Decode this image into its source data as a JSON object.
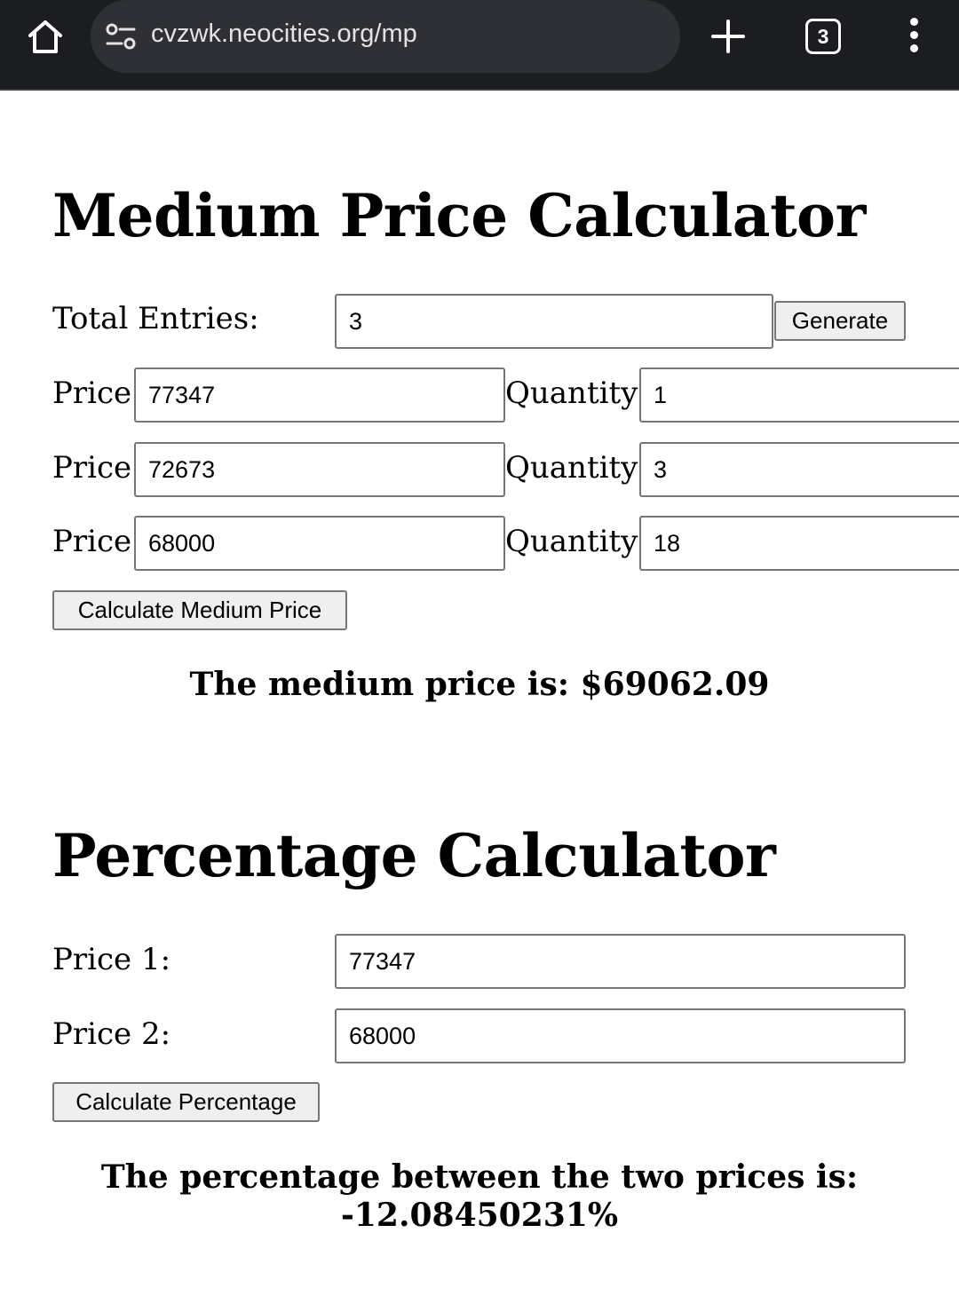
{
  "browser": {
    "url": "cvzwk.neocities.org/mp",
    "tab_count": "3"
  },
  "medium_calc": {
    "title": "Medium Price Calculator",
    "total_entries_label": "Total Entries:",
    "total_entries_value": "3",
    "generate_label": "Generate",
    "price_label": "Price:",
    "quantity_label": "Quantity:",
    "rows": [
      {
        "price": "77347",
        "quantity": "1"
      },
      {
        "price": "72673",
        "quantity": "3"
      },
      {
        "price": "68000",
        "quantity": "18"
      }
    ],
    "calculate_label": "Calculate Medium Price",
    "result": "The medium price is: $69062.09"
  },
  "percent_calc": {
    "title": "Percentage Calculator",
    "price1_label": "Price 1:",
    "price1_value": "77347",
    "price2_label": "Price 2:",
    "price2_value": "68000",
    "calculate_label": "Calculate Percentage",
    "result_line1": "The percentage between the two prices is:",
    "result_line2": "-12.08450231%"
  }
}
